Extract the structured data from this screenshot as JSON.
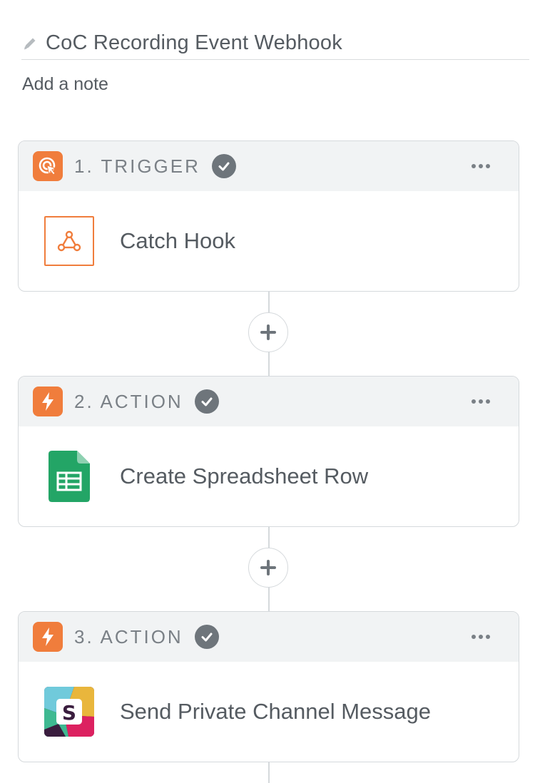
{
  "zap": {
    "title": "CoC Recording Event Webhook",
    "add_note_label": "Add a note"
  },
  "colors": {
    "accent": "#f07d3c",
    "check": "#6e757b",
    "header_bg": "#f1f3f4",
    "text": "#555b61"
  },
  "steps": [
    {
      "label": "1. TRIGGER",
      "type_icon": "target-cursor-icon",
      "app_icon": "webhook-icon",
      "app_name": "Catch Hook",
      "status": "check-icon"
    },
    {
      "label": "2. ACTION",
      "type_icon": "lightning-bolt-icon",
      "app_icon": "google-sheets-icon",
      "app_name": "Create Spreadsheet Row",
      "status": "check-icon"
    },
    {
      "label": "3. ACTION",
      "type_icon": "lightning-bolt-icon",
      "app_icon": "slack-icon",
      "app_name": "Send Private Channel Message",
      "status": "check-icon"
    }
  ]
}
